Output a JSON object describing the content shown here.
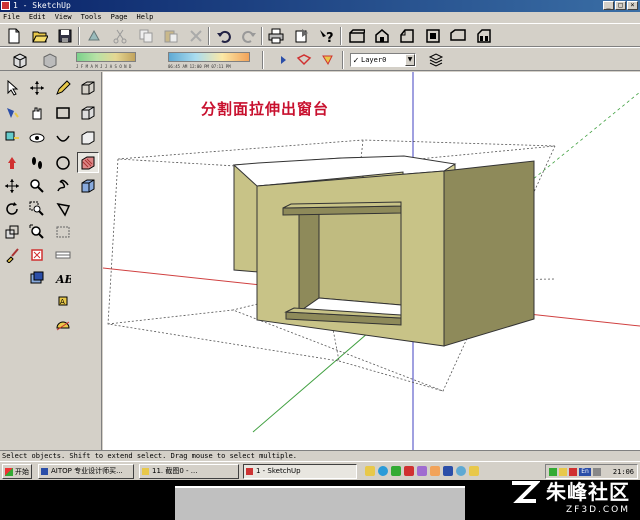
{
  "window": {
    "title": "1 - SketchUp",
    "controls": [
      "_",
      "□",
      "×"
    ]
  },
  "menu": [
    "File",
    "Edit",
    "View",
    "Tools",
    "Page",
    "Help"
  ],
  "toolbar": {
    "icons": [
      "new-file-icon",
      "open-folder-icon",
      "save-icon",
      "erase-paint-icon",
      "cut-icon",
      "copy-icon",
      "paste-icon",
      "delete-icon",
      "undo-icon",
      "redo-icon",
      "print-icon",
      "model-info-icon",
      "help-icon",
      "iso-view-icon",
      "top-view-icon",
      "front-view-icon",
      "right-view-icon",
      "back-view-icon",
      "left-view-icon",
      "house-view-icon"
    ],
    "shadow_labels": [
      "J F M A M J J A S O N D",
      "06:45 AM  12:00 PM  07:11 PM"
    ]
  },
  "layer": {
    "check": "✓",
    "name": "Layer0",
    "arrow": "▼"
  },
  "caption": "分割面拉伸出窗台",
  "status": "Select objects. Shift to extend select. Drag mouse to select multiple.",
  "taskbar": {
    "start": "开始",
    "tasks": [
      {
        "label": "AITOP 专业设计师买..."
      },
      {
        "label": "11. 截图0 -  ..."
      },
      {
        "label": "1 - SketchUp"
      }
    ],
    "tray": {
      "ime": "En",
      "clock": "21:06"
    }
  },
  "watermark": {
    "text": "朱峰社区",
    "url": "ZF3D.COM"
  },
  "colors": {
    "wall_face": "#c8c387",
    "wall_shadow": "#8e8a5a",
    "titlebar": "#0a246a",
    "caption": "#c8102e",
    "axis_red": "#d04040",
    "axis_green": "#40a040",
    "axis_blue": "#4040c0"
  }
}
